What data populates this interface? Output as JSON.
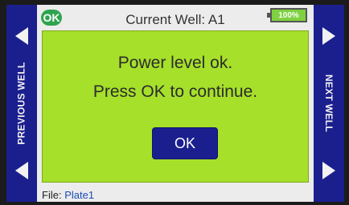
{
  "header": {
    "badge": "OK",
    "title": "Current Well: A1",
    "battery": "100%"
  },
  "left_nav": {
    "label": "PREVIOUS WELL"
  },
  "right_nav": {
    "label": "NEXT WELL"
  },
  "dialog": {
    "line1": "Power level ok.",
    "line2": "Press OK to continue.",
    "button": "OK"
  },
  "footer": {
    "label": "File:",
    "value": "Plate1"
  },
  "colors": {
    "nav": "#1b1f8e",
    "panel": "#a6e02a",
    "badge": "#2ea44f",
    "battery": "#7ed140"
  }
}
